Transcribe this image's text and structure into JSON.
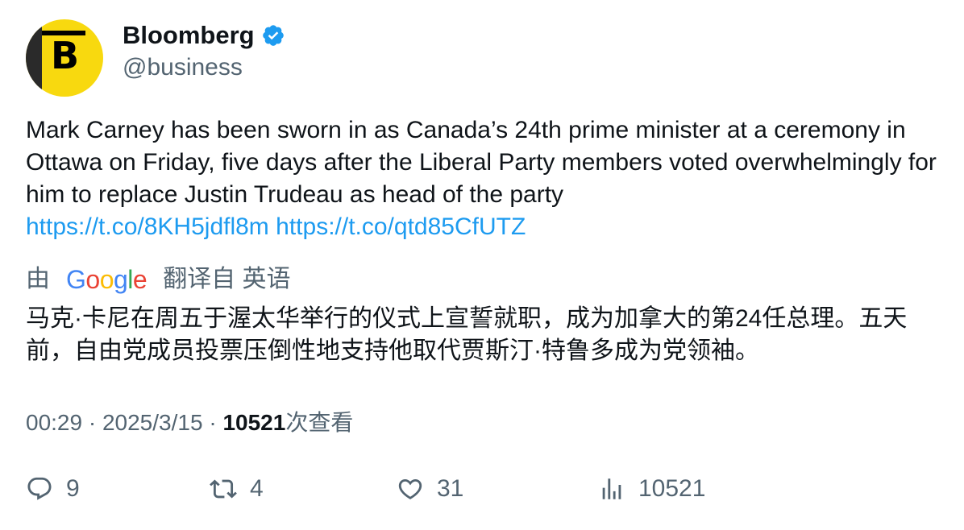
{
  "author": {
    "display_name": "Bloomberg",
    "handle": "@business",
    "avatar_letter": "B",
    "verified": true,
    "brand_color": "#f8d90f"
  },
  "tweet": {
    "text": "Mark Carney has been sworn in as Canada’s 24th prime minister at a ceremony in Ottawa on Friday, five days after the Liberal Party members voted overwhelmingly for him to replace Justin Trudeau as head of the party",
    "links": [
      "https://t.co/8KH5jdfl8m",
      "https://t.co/qtd85CfUTZ"
    ]
  },
  "translation": {
    "by_label": "由",
    "provider": "Google",
    "from_label": "翻译自 英语",
    "text": "马克·卡尼在周五于渥太华举行的仪式上宣誓就职，成为加拿大的第24任总理。五天前，自由党成员投票压倒性地支持他取代贾斯汀·特鲁多成为党领袖。"
  },
  "meta": {
    "time": "00:29",
    "date": "2025/3/15",
    "separator": "·",
    "views": "10521",
    "views_label": "次查看"
  },
  "actions": {
    "replies": "9",
    "retweets": "4",
    "likes": "31",
    "views": "10521"
  },
  "colors": {
    "link": "#1d9bf0",
    "secondary_text": "#536471",
    "primary_text": "#0f1419",
    "verified_badge": "#1d9bf0"
  }
}
